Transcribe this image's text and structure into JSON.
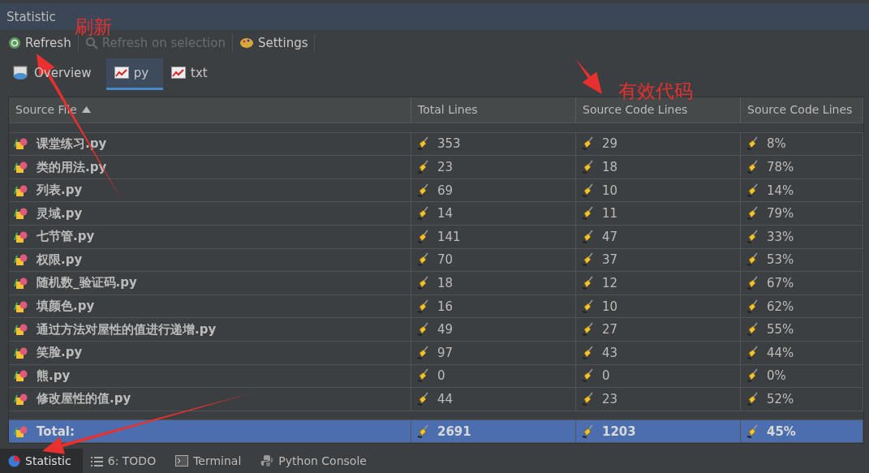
{
  "panel": {
    "title": "Statistic"
  },
  "toolbar": [
    {
      "kind": "refresh",
      "label": "Refresh",
      "disabled": false
    },
    {
      "kind": "search",
      "label": "Refresh on selection",
      "disabled": true
    },
    {
      "kind": "settings",
      "label": "Settings",
      "disabled": false
    }
  ],
  "tabs": [
    {
      "kind": "overview",
      "label": "Overview",
      "selected": false
    },
    {
      "kind": "chart",
      "label": "py",
      "selected": true
    },
    {
      "kind": "chart",
      "label": "txt",
      "selected": false
    }
  ],
  "table": {
    "columns": [
      {
        "label": "Source File",
        "sorted": true
      },
      {
        "label": "Total Lines",
        "sorted": false
      },
      {
        "label": "Source Code Lines",
        "sorted": false
      },
      {
        "label": "Source Code Lines",
        "sorted": false
      }
    ],
    "rows": [
      {
        "cells": [
          "课堂练习.py",
          "353",
          "29",
          "8%"
        ]
      },
      {
        "cells": [
          "类的用法.py",
          "23",
          "18",
          "78%"
        ]
      },
      {
        "cells": [
          "列表.py",
          "69",
          "10",
          "14%"
        ]
      },
      {
        "cells": [
          "灵域.py",
          "14",
          "11",
          "79%"
        ]
      },
      {
        "cells": [
          "七节管.py",
          "141",
          "47",
          "33%"
        ]
      },
      {
        "cells": [
          "权限.py",
          "70",
          "37",
          "53%"
        ]
      },
      {
        "cells": [
          "随机数_验证码.py",
          "18",
          "12",
          "67%"
        ]
      },
      {
        "cells": [
          "填颜色.py",
          "16",
          "10",
          "62%"
        ]
      },
      {
        "cells": [
          "通过方法对屋性的值进行递增.py",
          "49",
          "27",
          "55%"
        ]
      },
      {
        "cells": [
          "笑脸.py",
          "97",
          "43",
          "44%"
        ]
      },
      {
        "cells": [
          "熊.py",
          "0",
          "0",
          "0%"
        ]
      },
      {
        "cells": [
          "修改屋性的值.py",
          "44",
          "23",
          "52%"
        ]
      }
    ],
    "total": {
      "selected": true,
      "cells": [
        "Total:",
        "2691",
        "1203",
        "45%"
      ]
    }
  },
  "tool_windows": [
    {
      "kind": "statistic",
      "label": "Statistic",
      "selected": true
    },
    {
      "kind": "todo",
      "label": "6: TODO",
      "selected": false
    },
    {
      "kind": "terminal",
      "label": "Terminal",
      "selected": false
    },
    {
      "kind": "python",
      "label": "Python Console",
      "selected": false
    }
  ],
  "annotations": [
    {
      "text": "刷新"
    },
    {
      "text": "有效代码"
    }
  ]
}
